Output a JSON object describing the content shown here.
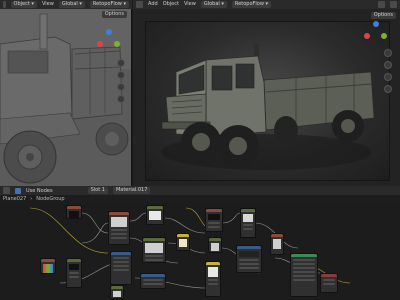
{
  "left_header": {
    "object_label": "Object",
    "menu_view": "View",
    "orientation": "Global",
    "plugin": "RetopoFlow"
  },
  "right_header": {
    "add": "Add",
    "object": "Object",
    "menu_view": "View",
    "orientation": "Global",
    "plugin": "RetopoFlow"
  },
  "viewport_left": {
    "options": "Options"
  },
  "viewport_right": {
    "options": "Options"
  },
  "node_editor": {
    "use_nodes_label": "Use Nodes",
    "slot": "Slot 1",
    "material": "Material.017",
    "breadcrumb_object": "Plane027",
    "breadcrumb_group": "NodeGroup"
  },
  "colors": {
    "gizmo_x": "#e0424a",
    "gizmo_y": "#7ab22e",
    "gizmo_z": "#3d7fe0",
    "truck_body": "#6f7266",
    "clay": "#5d5d5d",
    "accent": "#4772b3"
  }
}
